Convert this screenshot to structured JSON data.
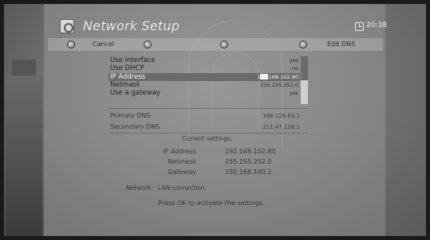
{
  "header": {
    "title": "Network Setup",
    "time": "20:38"
  },
  "buttons": {
    "red_label": "Cancel",
    "blue_label": "Edit DNS"
  },
  "settings": [
    {
      "label": "Use Interface",
      "value": "yes"
    },
    {
      "label": "Use DHCP",
      "value": "no"
    },
    {
      "label": "IP Address",
      "value": "192.168.102.80",
      "selected": true
    },
    {
      "label": "Netmask",
      "value": "255.255.252.0"
    },
    {
      "label": "Use a gateway",
      "value": "yes"
    }
  ],
  "dns": [
    {
      "label": "Primary DNS",
      "value": "168.126.63.1"
    },
    {
      "label": "Secondary DNS",
      "value": "211.47.128.1"
    }
  ],
  "current": {
    "title": "Current settings:",
    "rows": [
      {
        "label": "IP Address",
        "value": "192.168.102.80"
      },
      {
        "label": "Netmask",
        "value": "255.255.252.0"
      },
      {
        "label": "Gateway",
        "value": "192.168.100.1"
      }
    ]
  },
  "network": {
    "label": "Network:",
    "value": "LAN connection"
  },
  "hint": "Press OK to activate the settings."
}
